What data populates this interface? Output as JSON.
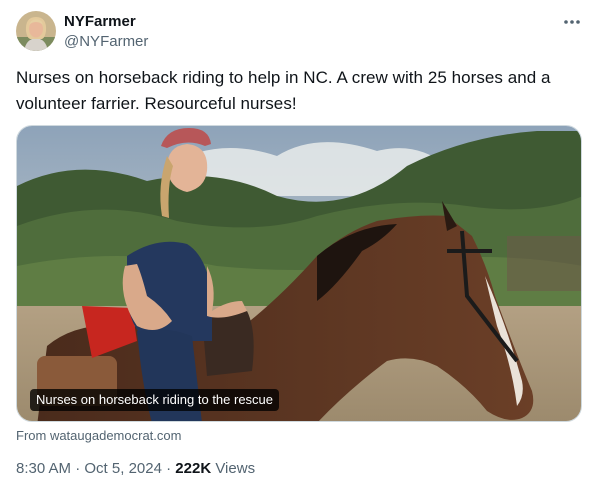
{
  "author": {
    "display_name": "NYFarmer",
    "handle": "@NYFarmer",
    "avatar_icon": "profile-photo"
  },
  "more_icon": "more-horizontal-icon",
  "tweet": {
    "text": "Nurses on horseback riding to help in NC. A crew with 25 horses and a volunteer farrier. Resourceful nurses!"
  },
  "media": {
    "caption": "Nurses on horseback riding to the rescue",
    "source": "From wataugademocrat.com"
  },
  "meta": {
    "time": "8:30 AM",
    "separator": " · ",
    "date": "Oct 5, 2024",
    "views_count": "222K",
    "views_label": " Views"
  },
  "colors": {
    "text_primary": "#0f1419",
    "text_secondary": "#536471",
    "border": "#cfd9de"
  }
}
